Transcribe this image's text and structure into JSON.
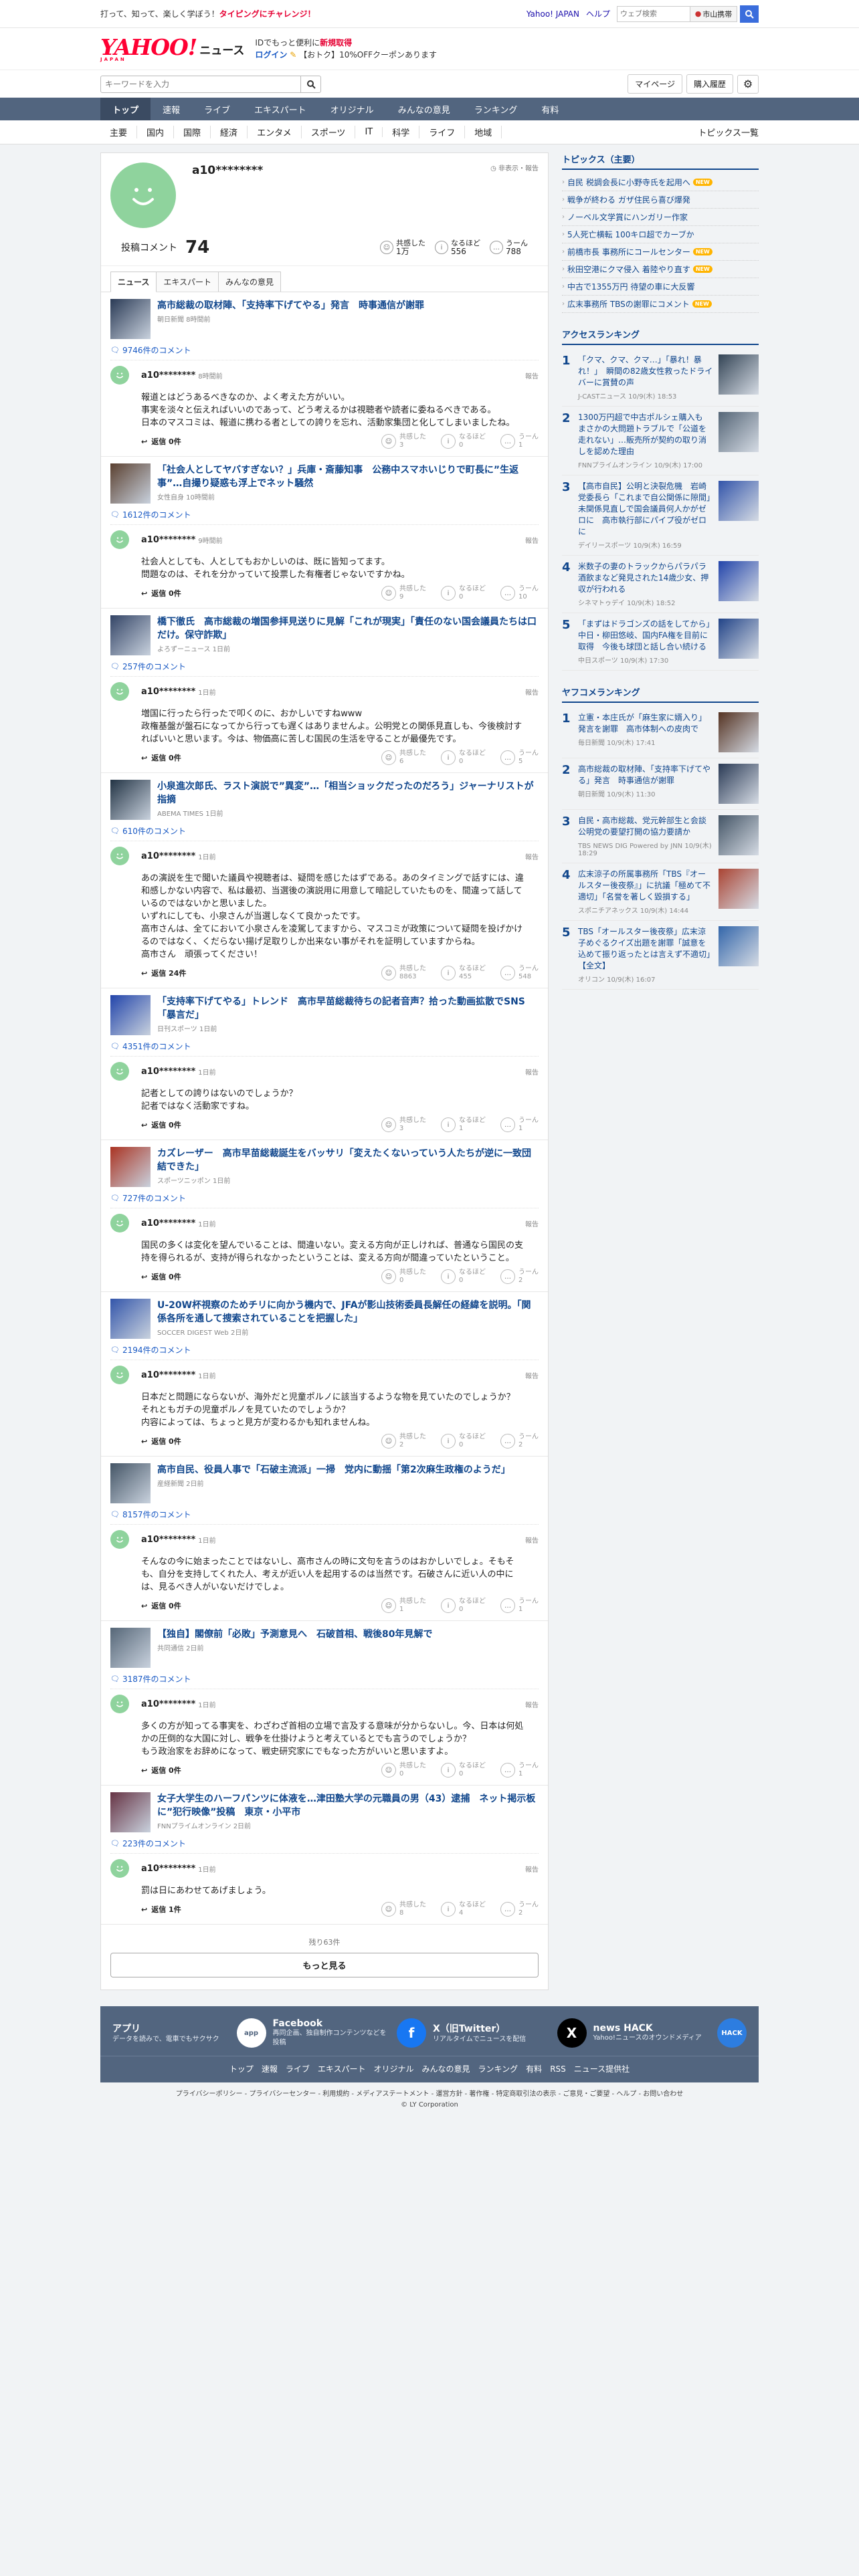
{
  "topbar": {
    "promo_pre": "打って、知って、楽しく学ぼう！",
    "promo_highlight": "タイピングにチャレンジ！",
    "links": [
      "Yahoo! JAPAN",
      "ヘルプ"
    ],
    "weather_placeholder": "ウェブ検索",
    "weather_label": "市山携帯"
  },
  "header": {
    "logo": "YAHOO!",
    "logo_sub": "JAPAN",
    "brand": "ニュース",
    "line1_pre": "IDでもっと便利に",
    "line1_highlight": "新規取得",
    "login": "ログイン",
    "coupon": "【おトク】10%OFFクーポンあります"
  },
  "search": {
    "placeholder": "キーワードを入力",
    "mypage": "マイページ",
    "purchased": "購入履歴"
  },
  "gnav": [
    "トップ",
    "速報",
    "ライブ",
    "エキスパート",
    "オリジナル",
    "みんなの意見",
    "ランキング",
    "有料"
  ],
  "subnav": [
    "主要",
    "国内",
    "国際",
    "経済",
    "エンタメ",
    "スポーツ",
    "IT",
    "科学",
    "ライフ",
    "地域"
  ],
  "subnav_right": "トピックス一覧",
  "profile": {
    "name": "a10********",
    "note": "非表示・報告",
    "count_label": "投稿コメント",
    "count": "74",
    "stats": [
      {
        "label": "共感した",
        "value": "1万"
      },
      {
        "label": "なるほど",
        "value": "556"
      },
      {
        "label": "うーん",
        "value": "788"
      }
    ]
  },
  "tabs": [
    "ニュース",
    "エキスパート",
    "みんなの意見"
  ],
  "entries": [
    {
      "title": "高市総裁の取材陣、「支持率下げてやる」発言　時事通信が謝罪",
      "source": "朝日新聞 8時間前",
      "count": "9746件のコメント",
      "time": "8時間前",
      "body": "報道とはどうあるべきなのか、よく考えた方がいい。\n事実を淡々と伝えればいいのであって、どう考えるかは視聴者や読者に委ねるべきである。\n日本のマスコミは、報道に携わる者としての誇りを忘れ、活動家集団と化してしまいましたね。",
      "reply": "返信 0件",
      "r": [
        "3",
        "0",
        "1"
      ],
      "color": "#2a3a55"
    },
    {
      "title": "「社会人としてヤバすぎない？」兵庫・斎藤知事　公務中スマホいじりで町長に”生返事”…自撮り疑惑も浮上でネット騒然",
      "source": "女性自身 10時間前",
      "count": "1612件のコメント",
      "time": "9時間前",
      "body": "社会人としても、人としてもおかしいのは、既に皆知ってます。\n問題なのは、それを分かっていて投票した有権者じゃないですかね。",
      "reply": "返信 0件",
      "r": [
        "9",
        "0",
        "10"
      ],
      "color": "#5a4030"
    },
    {
      "title": "橋下徹氏　高市総裁の増国参拝見送りに見解「これが現実」「責任のない国会議員たちは口だけ。保守詐欺」",
      "source": "よろずーニュース 1日前",
      "count": "257件のコメント",
      "time": "1日前",
      "body": "増国に行ったら行ったで叩くのに、おかしいですねwww\n政権基盤が盤石になってから行っても遅くはありませんよ。公明党との関係見直しも、今後検討すればいいと思います。今は、物価高に苦しむ国民の生活を守ることが最優先です。",
      "reply": "返信 0件",
      "r": [
        "6",
        "0",
        "5"
      ],
      "color": "#334466"
    },
    {
      "title": "小泉進次郎氏、ラスト演説で”異変”…「相当ショックだったのだろう」ジャーナリストが指摘",
      "source": "ABEMA TIMES 1日前",
      "count": "610件のコメント",
      "time": "1日前",
      "body": "あの演説を生で聞いた議員や視聴者は、疑問を感じたはずである。あのタイミングで話すには、違和感しかない内容で、私は最初、当選後の演説用に用意して暗記していたものを、間違って話しているのではないかと思いました。\nいずれにしても、小泉さんが当選しなくて良かったです。\n高市さんは、全てにおいて小泉さんを凌駕してますから、マスコミが政策について疑問を投げかけるのではなく、くだらない揚げ足取りしか出来ない事がそれを証明していますからね。\n高市さん　頑張ってください！",
      "reply": "返信 24件",
      "r": [
        "8863",
        "455",
        "548"
      ],
      "color": "#223344"
    },
    {
      "title": "「支持率下げてやる」トレンド　高市早苗総裁待ちの記者音声？拾った動画拡散でSNS「暴言だ」",
      "source": "日刊スポーツ 1日前",
      "count": "4351件のコメント",
      "time": "1日前",
      "body": "記者としての誇りはないのでしょうか？\n記者ではなく活動家ですね。",
      "reply": "返信 0件",
      "r": [
        "3",
        "1",
        "1"
      ],
      "color": "#2244aa"
    },
    {
      "title": "カズレーザー　高市早苗総裁誕生をバッサリ「変えたくないっていう人たちが逆に一致団結できた」",
      "source": "スポーツニッポン 1日前",
      "count": "727件のコメント",
      "time": "1日前",
      "body": "国民の多くは変化を望んでいることは、間違いない。変える方向が正しければ、普通なら国民の支持を得られるが、支持が得られなかったということは、変える方向が間違っていたということ。",
      "reply": "返信 0件",
      "r": [
        "0",
        "0",
        "2"
      ],
      "color": "#aa3322"
    },
    {
      "title": "U-20W杯視察のためチリに向かう機内で、JFAが影山技術委員長解任の経緯を説明。「関係各所を通して捜索されていることを把握した」",
      "source": "SOCCER DIGEST Web 2日前",
      "count": "2194件のコメント",
      "time": "1日前",
      "body": "日本だと問題にならないが、海外だと児童ポルノに該当するような物を見ていたのでしょうか？\nそれともガチの児童ポルノを見ていたのでしょうか？\n内容によっては、ちょっと見方が変わるかも知れませんね。",
      "reply": "返信 0件",
      "r": [
        "2",
        "0",
        "2"
      ],
      "color": "#3355aa"
    },
    {
      "title": "高市自民、役員人事で「石破主流派」一掃　党内に動揺「第2次麻生政権のようだ」",
      "source": "産経新聞 2日前",
      "count": "8157件のコメント",
      "time": "1日前",
      "body": "そんなの今に始まったことではないし、高市さんの時に文句を言うのはおかしいでしょ。そもそも、自分を支持してくれた人、考えが近い人を起用するのは当然です。石破さんに近い人の中には、見るべき人がいないだけでしょ。",
      "reply": "返信 0件",
      "r": [
        "1",
        "0",
        "1"
      ],
      "color": "#445566"
    },
    {
      "title": "【独自】閣僚前「必敗」予測意見へ　石破首相、戦後80年見解で",
      "source": "共同通信 2日前",
      "count": "3187件のコメント",
      "time": "1日前",
      "body": "多くの方が知ってる事実を、わざわざ首相の立場で言及する意味が分からないし。今、日本は何処かの圧倒的な大国に対し、戦争を仕掛けようと考えているとでも言うのでしょうか？\nもう政治家をお辞めになって、戦史研究家にでもなった方がいいと思いますよ。",
      "reply": "返信 0件",
      "r": [
        "0",
        "0",
        "1"
      ],
      "color": "#556677"
    },
    {
      "title": "女子大学生のハーフパンツに体液を…津田塾大学の元職員の男（43）逮捕　ネット掲示板に”犯行映像”投稿　東京・小平市",
      "source": "FNNプライムオンライン 2日前",
      "count": "223件のコメント",
      "time": "1日前",
      "body": "罰は日にあわせてあげましょう。",
      "reply": "返信 1件",
      "r": [
        "8",
        "4",
        "2"
      ],
      "color": "#663344"
    }
  ],
  "more": {
    "remain": "残り63件",
    "button": "もっと見る"
  },
  "reactions_labels": [
    "共感した",
    "なるほど",
    "うーん"
  ],
  "report": "報告",
  "side": {
    "topics_title": "トピックス（主要）",
    "topics": [
      {
        "t": "自民 税調会長に小野寺氏を起用へ",
        "new": "NEW"
      },
      {
        "t": "戦争が終わる ガザ住民ら喜び爆発",
        "new": ""
      },
      {
        "t": "ノーベル文学賞にハンガリー作家",
        "new": ""
      },
      {
        "t": "5人死亡横転 100キロ超でカーブか",
        "new": ""
      },
      {
        "t": "前橋市長 事務所にコールセンター",
        "new": "NEW"
      },
      {
        "t": "秋田空港にクマ侵入 着陸やり直す",
        "new": "NEW"
      },
      {
        "t": "中古で1355万円 待望の車に大反響",
        "new": ""
      },
      {
        "t": "広末事務所 TBSの謝罪にコメント",
        "new": "NEW"
      }
    ],
    "access_title": "アクセスランキング",
    "access": [
      {
        "t": "「クマ、クマ、クマ…」「暴れ！暴れ！」　瞬間の82歳女性救ったドライバーに賞賛の声",
        "s": "J-CASTニュース 10/9(木) 18:53",
        "c": "#334455"
      },
      {
        "t": "1300万円超で中古ポルシェ購入も まさかの大問題トラブルで「公道を走れない」…販売所が契約の取り消しを認めた理由",
        "s": "FNNプライムオンライン 10/9(木) 17:00",
        "c": "#556677"
      },
      {
        "t": "【高市自民】公明と決裂危機　岩崎党委長ら「これまで自公関係に隙間」未関係見直しで国会議員何人かがゼロに　高市執行部にパイプ役がゼロに",
        "s": "デイリースポーツ 10/9(木) 16:59",
        "c": "#3355aa"
      },
      {
        "t": "米数子の妻のトラックからパラパラ酒飲まなど発見された14歳少女、押収が行われる",
        "s": "シネマトゥデイ 10/9(木) 18:52",
        "c": "#2244aa"
      },
      {
        "t": "「まずはドラゴンズの話をしてから」中日・柳田悠岐、国内FA権を目前に取得　今後も球団と話し合い続ける",
        "s": "中日スポーツ 10/9(木) 17:30",
        "c": "#224488"
      }
    ],
    "yahoo_title": "ヤフコメランキング",
    "yahoo": [
      {
        "t": "立憲・本庄氏が「麻生家に婿入り」発言を謝罪　高市体制への皮肉で",
        "s": "毎日新聞 10/9(木) 17:41",
        "c": "#553322"
      },
      {
        "t": "高市総裁の取材陣、「支持率下げてやる」発言　時事通信が謝罪",
        "s": "朝日新聞 10/9(木) 11:30",
        "c": "#2a3a55"
      },
      {
        "t": "自民・高市総裁、党元幹部生と会談　公明党の要望打開の協力要請か",
        "s": "TBS NEWS DIG Powered by JNN 10/9(木) 18:29",
        "c": "#445566"
      },
      {
        "t": "広末涼子の所属事務所「TBS『オールスター後夜祭』」に抗議「極めて不適切」「名誉を著しく毀損する」",
        "s": "スポニチアネックス 10/9(木) 14:44",
        "c": "#aa4433"
      },
      {
        "t": "TBS「オールスター後夜祭」広末涼子めぐるクイズ出題を謝罪「誠意を込めて振り返ったとは言えず不適切」【全文】",
        "s": "オリコン 10/9(木) 16:07",
        "c": "#3366aa"
      }
    ]
  },
  "footer": {
    "cols": [
      {
        "t": "アプリ",
        "d": "データを読みで、電車でもサクサク",
        "icon": "app",
        "c": "#ffffff",
        "tc": "#52657f"
      },
      {
        "t": "Facebook",
        "d": "再同企画、独自制作コンテンツなどを投稿",
        "icon": "f",
        "c": "#1877f2",
        "tc": "#ffffff"
      },
      {
        "t": "X（旧Twitter）",
        "d": "リアルタイムでニュースを配信",
        "icon": "X",
        "c": "#000000",
        "tc": "#ffffff"
      },
      {
        "t": "news HACK",
        "d": "Yahoo!ニュースのオウンドメディア",
        "icon": "HACK",
        "c": "#2d7de0",
        "tc": "#ffffff"
      }
    ],
    "links": [
      "トップ",
      "速報",
      "ライブ",
      "エキスパート",
      "オリジナル",
      "みんなの意見",
      "ランキング",
      "有料",
      "RSS",
      "ニュース提供社"
    ]
  },
  "legal": {
    "line1": "プライバシーポリシー - プライバシーセンター - 利用規約 - メディアステートメント - 運営方針 - 著作権 - 特定商取引法の表示 - ご意見・ご要望 - ヘルプ - お問い合わせ",
    "line2": "© LY Corporation"
  }
}
